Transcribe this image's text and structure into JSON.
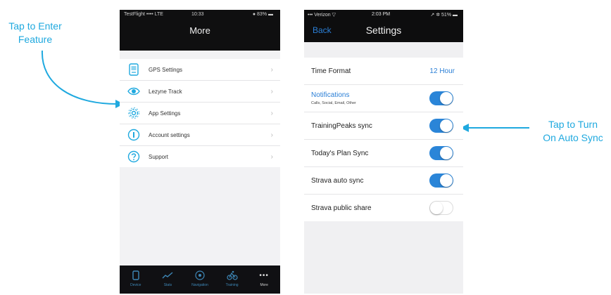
{
  "callouts": {
    "left_line1": "Tap to Enter",
    "left_line2": "Feature",
    "right_line1": "Tap to Turn",
    "right_line2": "On Auto Sync"
  },
  "colors": {
    "accent": "#1fa9df",
    "link_blue": "#2b7fd6",
    "toggle_on": "#2a85d8"
  },
  "phone1": {
    "status": {
      "carrier": "TestFlight •••• LTE",
      "time": "10:33",
      "battery": "● 83% ▬"
    },
    "title": "More",
    "menu": [
      {
        "label": "GPS Settings",
        "icon": "gps-device-icon"
      },
      {
        "label": "Lezyne Track",
        "icon": "eye-track-icon"
      },
      {
        "label": "App Settings",
        "icon": "gear-icon"
      },
      {
        "label": "Account settings",
        "icon": "account-info-icon"
      },
      {
        "label": "Support",
        "icon": "question-icon"
      }
    ],
    "chevron": "›",
    "tabs": [
      {
        "label": "Device",
        "icon": "device-icon"
      },
      {
        "label": "Stats",
        "icon": "stats-icon"
      },
      {
        "label": "Navigation",
        "icon": "navigation-icon"
      },
      {
        "label": "Training",
        "icon": "training-icon"
      },
      {
        "label": "More",
        "icon": "more-icon",
        "glyph": "•••",
        "active": true
      }
    ]
  },
  "phone2": {
    "status": {
      "carrier": "••• Verizon ▽",
      "time": "2:03 PM",
      "battery": "↗ ✲ 51% ▬"
    },
    "back_label": "Back",
    "title": "Settings",
    "time_format": {
      "label": "Time Format",
      "value": "12 Hour"
    },
    "notifications": {
      "label": "Notifications",
      "sub": "Calls, Social, Email, Other",
      "on": true
    },
    "toggles": [
      {
        "label": "TrainingPeaks sync",
        "on": true
      },
      {
        "label": "Today's Plan Sync",
        "on": true
      },
      {
        "label": "Strava auto sync",
        "on": true
      },
      {
        "label": "Strava public share",
        "on": false
      }
    ]
  }
}
